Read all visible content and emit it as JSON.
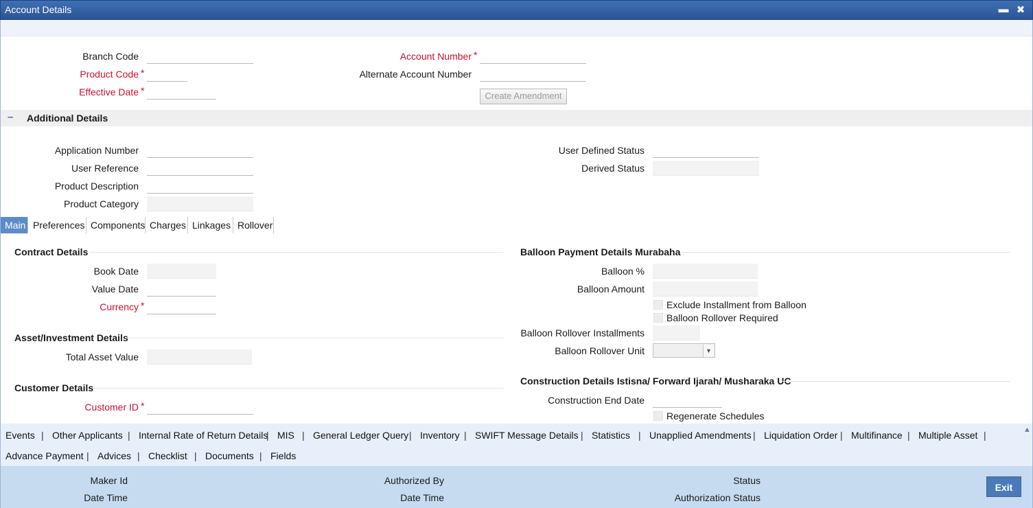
{
  "window": {
    "title": "Account Details",
    "minimize": "▬",
    "close": "✖"
  },
  "header_fields": {
    "branch_code": "Branch Code",
    "product_code": "Product Code",
    "effective_date": "Effective Date",
    "account_number": "Account Number",
    "alternate_account_number": "Alternate Account Number",
    "create_amendment": "Create Amendment",
    "required_mark": "*"
  },
  "additional": {
    "toggle": "–",
    "title": "Additional Details",
    "application_number": "Application Number",
    "user_reference": "User Reference",
    "product_description": "Product Description",
    "product_category": "Product Category",
    "user_defined_status": "User Defined Status",
    "derived_status": "Derived Status"
  },
  "tabs": [
    "Main",
    "Preferences",
    "Components",
    "Charges",
    "Linkages",
    "Rollover"
  ],
  "contract": {
    "title": "Contract Details",
    "book_date": "Book Date",
    "value_date": "Value Date",
    "currency": "Currency"
  },
  "asset": {
    "title": "Asset/Investment Details",
    "total_asset_value": "Total Asset Value"
  },
  "customer": {
    "title": "Customer Details",
    "customer_id": "Customer ID"
  },
  "balloon": {
    "title": "Balloon Payment Details Murabaha",
    "balloon_pct": "Balloon %",
    "balloon_amount": "Balloon Amount",
    "exclude_installment": "Exclude Installment from Balloon",
    "rollover_required": "Balloon Rollover Required",
    "rollover_installments": "Balloon Rollover Installments",
    "rollover_unit": "Balloon Rollover Unit"
  },
  "construction": {
    "title": "Construction Details Istisna/ Forward Ijarah/ Musharaka UC",
    "end_date": "Construction End Date",
    "regenerate": "Regenerate Schedules"
  },
  "links_row1": [
    "Events",
    "Other Applicants",
    "Internal Rate of Return Details",
    "MIS",
    "General Ledger Query",
    "Inventory",
    "SWIFT Message Details",
    "Statistics",
    "Unapplied Amendments",
    "Liquidation Order",
    "Multifinance",
    "Multiple Asset"
  ],
  "links_row2": [
    "Advance Payment",
    "Advices",
    "Checklist",
    "Documents",
    "Fields"
  ],
  "separator": "|",
  "footer": {
    "maker_id": "Maker Id",
    "date_time_1": "Date Time",
    "authorized_by": "Authorized By",
    "date_time_2": "Date Time",
    "status": "Status",
    "authorization_status": "Authorization Status",
    "exit": "Exit"
  },
  "colors": {
    "title_bar": "#2f5da3",
    "required": "#c8102e",
    "active_tab": "#5c8cc9",
    "footer": "#c6dbf0"
  }
}
